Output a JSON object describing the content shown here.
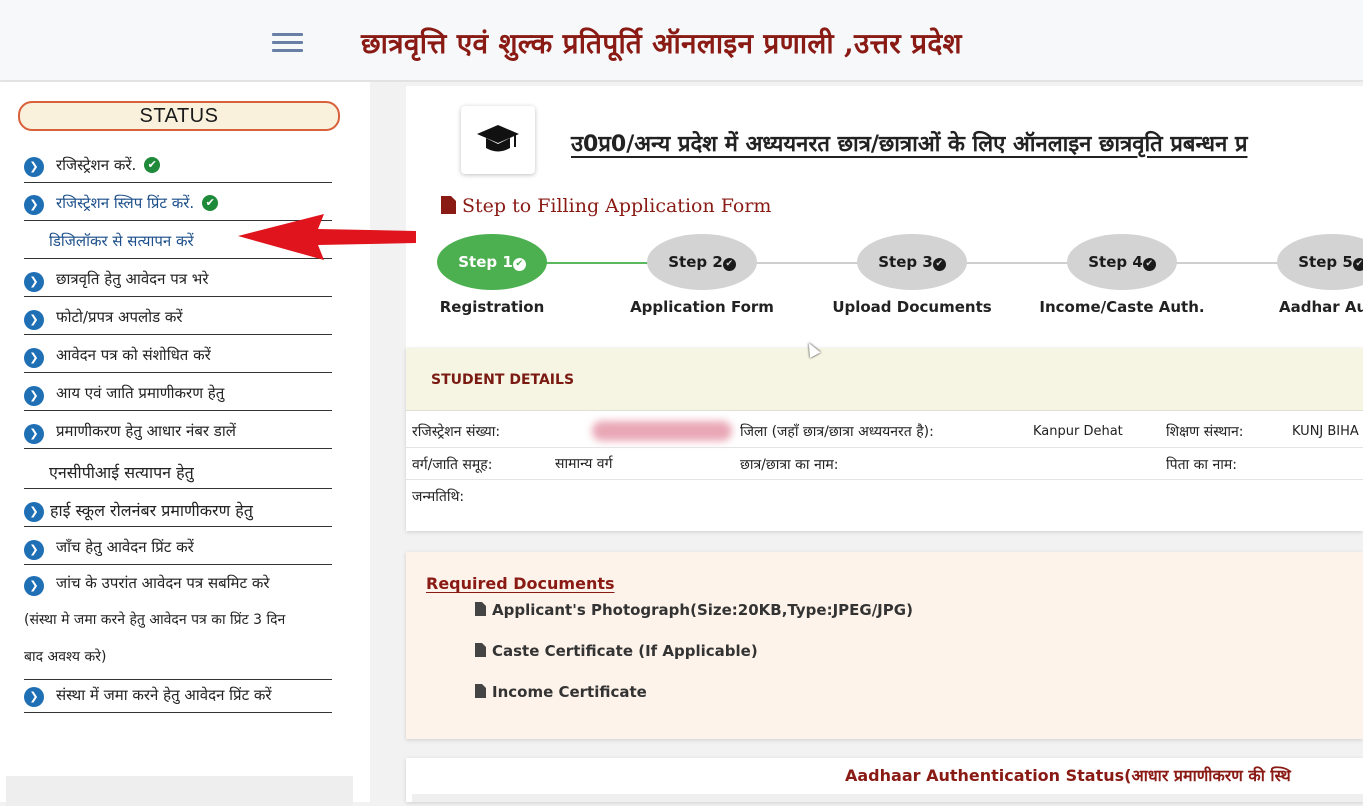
{
  "header": {
    "site_title": "छात्रवृत्ति एवं शुल्क प्रतिपूर्ति ऑनलाइन प्रणाली ,उत्तर प्रदेश",
    "menu_icon": "hamburger-icon"
  },
  "sidebar": {
    "status_label": "STATUS",
    "items": [
      {
        "label": "रजिस्ट्रेशन करें.",
        "done": true
      },
      {
        "label": "रजिस्ट्रेशन स्लिप प्रिंट करें.",
        "done": true
      },
      {
        "label": "डिजिलॉकर से सत्यापन करें"
      },
      {
        "label": "छात्रवृति हेतु आवेदन पत्र भरे"
      },
      {
        "label": "फोटो/प्रपत्र अपलोड करें"
      },
      {
        "label": "आवेदन पत्र को संशोधित करें"
      },
      {
        "label": "आय एवं जाति प्रमाणीकरण हेतु"
      },
      {
        "label": "प्रमाणीकरण हेतु आधार नंबर डालें"
      },
      {
        "label": "एनसीपीआई सत्यापन हेतु"
      },
      {
        "label": "हाई स्कूल रोलनंबर प्रमाणीकरण हेतु"
      },
      {
        "label": "जाँच हेतु आवेदन प्रिंट करें"
      },
      {
        "label": "जांच के उपरांत आवेदन पत्र सबमिट करे"
      },
      {
        "label": "संस्था में जमा करने हेतु आवेदन प्रिंट करें"
      }
    ],
    "submit_note_line1": "(संस्था मे जमा करने हेतु आवेदन पत्र का प्रिंट 3 दिन",
    "submit_note_line2": "बाद अवश्य करे)"
  },
  "main": {
    "title": "उ0प्र0/अन्य प्रदेश में अध्ययनरत छात्र/छात्राओं के लिए ऑनलाइन छात्रवृति प्रबन्धन प्र",
    "steps_heading": "Step to Filling Application Form",
    "steps": [
      {
        "pill": "Step 1",
        "label": "Registration",
        "done": true
      },
      {
        "pill": "Step 2",
        "label": "Application Form",
        "done": false
      },
      {
        "pill": "Step 3",
        "label": "Upload Documents",
        "done": false
      },
      {
        "pill": "Step 4",
        "label": "Income/Caste Auth.",
        "done": false
      },
      {
        "pill": "Step 5",
        "label": "Aadhar Au",
        "done": false
      }
    ],
    "student": {
      "heading": "STUDENT DETAILS",
      "reg_label": "रजिस्ट्रेशन संख्या:",
      "district_label": "जिला (जहाँ छात्र/छात्रा अध्ययनरत है):",
      "district_value": "Kanpur Dehat",
      "institute_label": "शिक्षण संस्थान:",
      "institute_value": "KUNJ BIHA",
      "category_label": "वर्ग/जाति समूह:",
      "category_value": "सामान्य वर्ग",
      "name_label": "छात्र/छात्रा का नाम:",
      "father_label": "पिता का नाम:",
      "dob_label": "जन्मतिथि:"
    },
    "required_docs": {
      "heading": "Required Documents",
      "items": [
        "Applicant's Photograph(Size:20KB,Type:JPEG/JPG)",
        "Caste Certificate (If Applicable)",
        "Income Certificate"
      ]
    },
    "aadhaar_title": "Aadhaar Authentication Status(आधार प्रमाणीकरण की स्थि"
  },
  "colors": {
    "brand_maroon": "#8a1a14",
    "step_done": "#4caf50",
    "step_pending": "#d3d3d3",
    "bullet_blue": "#1f6fb5",
    "arrow_red": "#e0141c"
  }
}
